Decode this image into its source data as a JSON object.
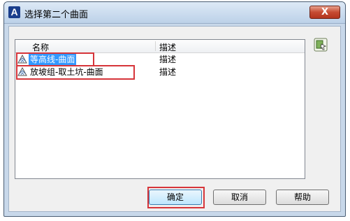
{
  "window": {
    "logo": "A",
    "title": "选择第二个曲面",
    "close_symbol": "X"
  },
  "list": {
    "columns": {
      "name": "名称",
      "description": "描述"
    },
    "rows": [
      {
        "name": "等高线-曲面",
        "description": "描述",
        "selected": true,
        "icon": "surface-icon"
      },
      {
        "name": "放坡组-取土坑-曲面",
        "description": "描述",
        "selected": false,
        "icon": "surface-icon"
      }
    ]
  },
  "side_icon": "select-from-drawing-icon",
  "buttons": {
    "ok": "确定",
    "cancel": "取消",
    "help": "帮助"
  },
  "colors": {
    "highlight": "#d6353a",
    "selection": "#3399ff"
  }
}
